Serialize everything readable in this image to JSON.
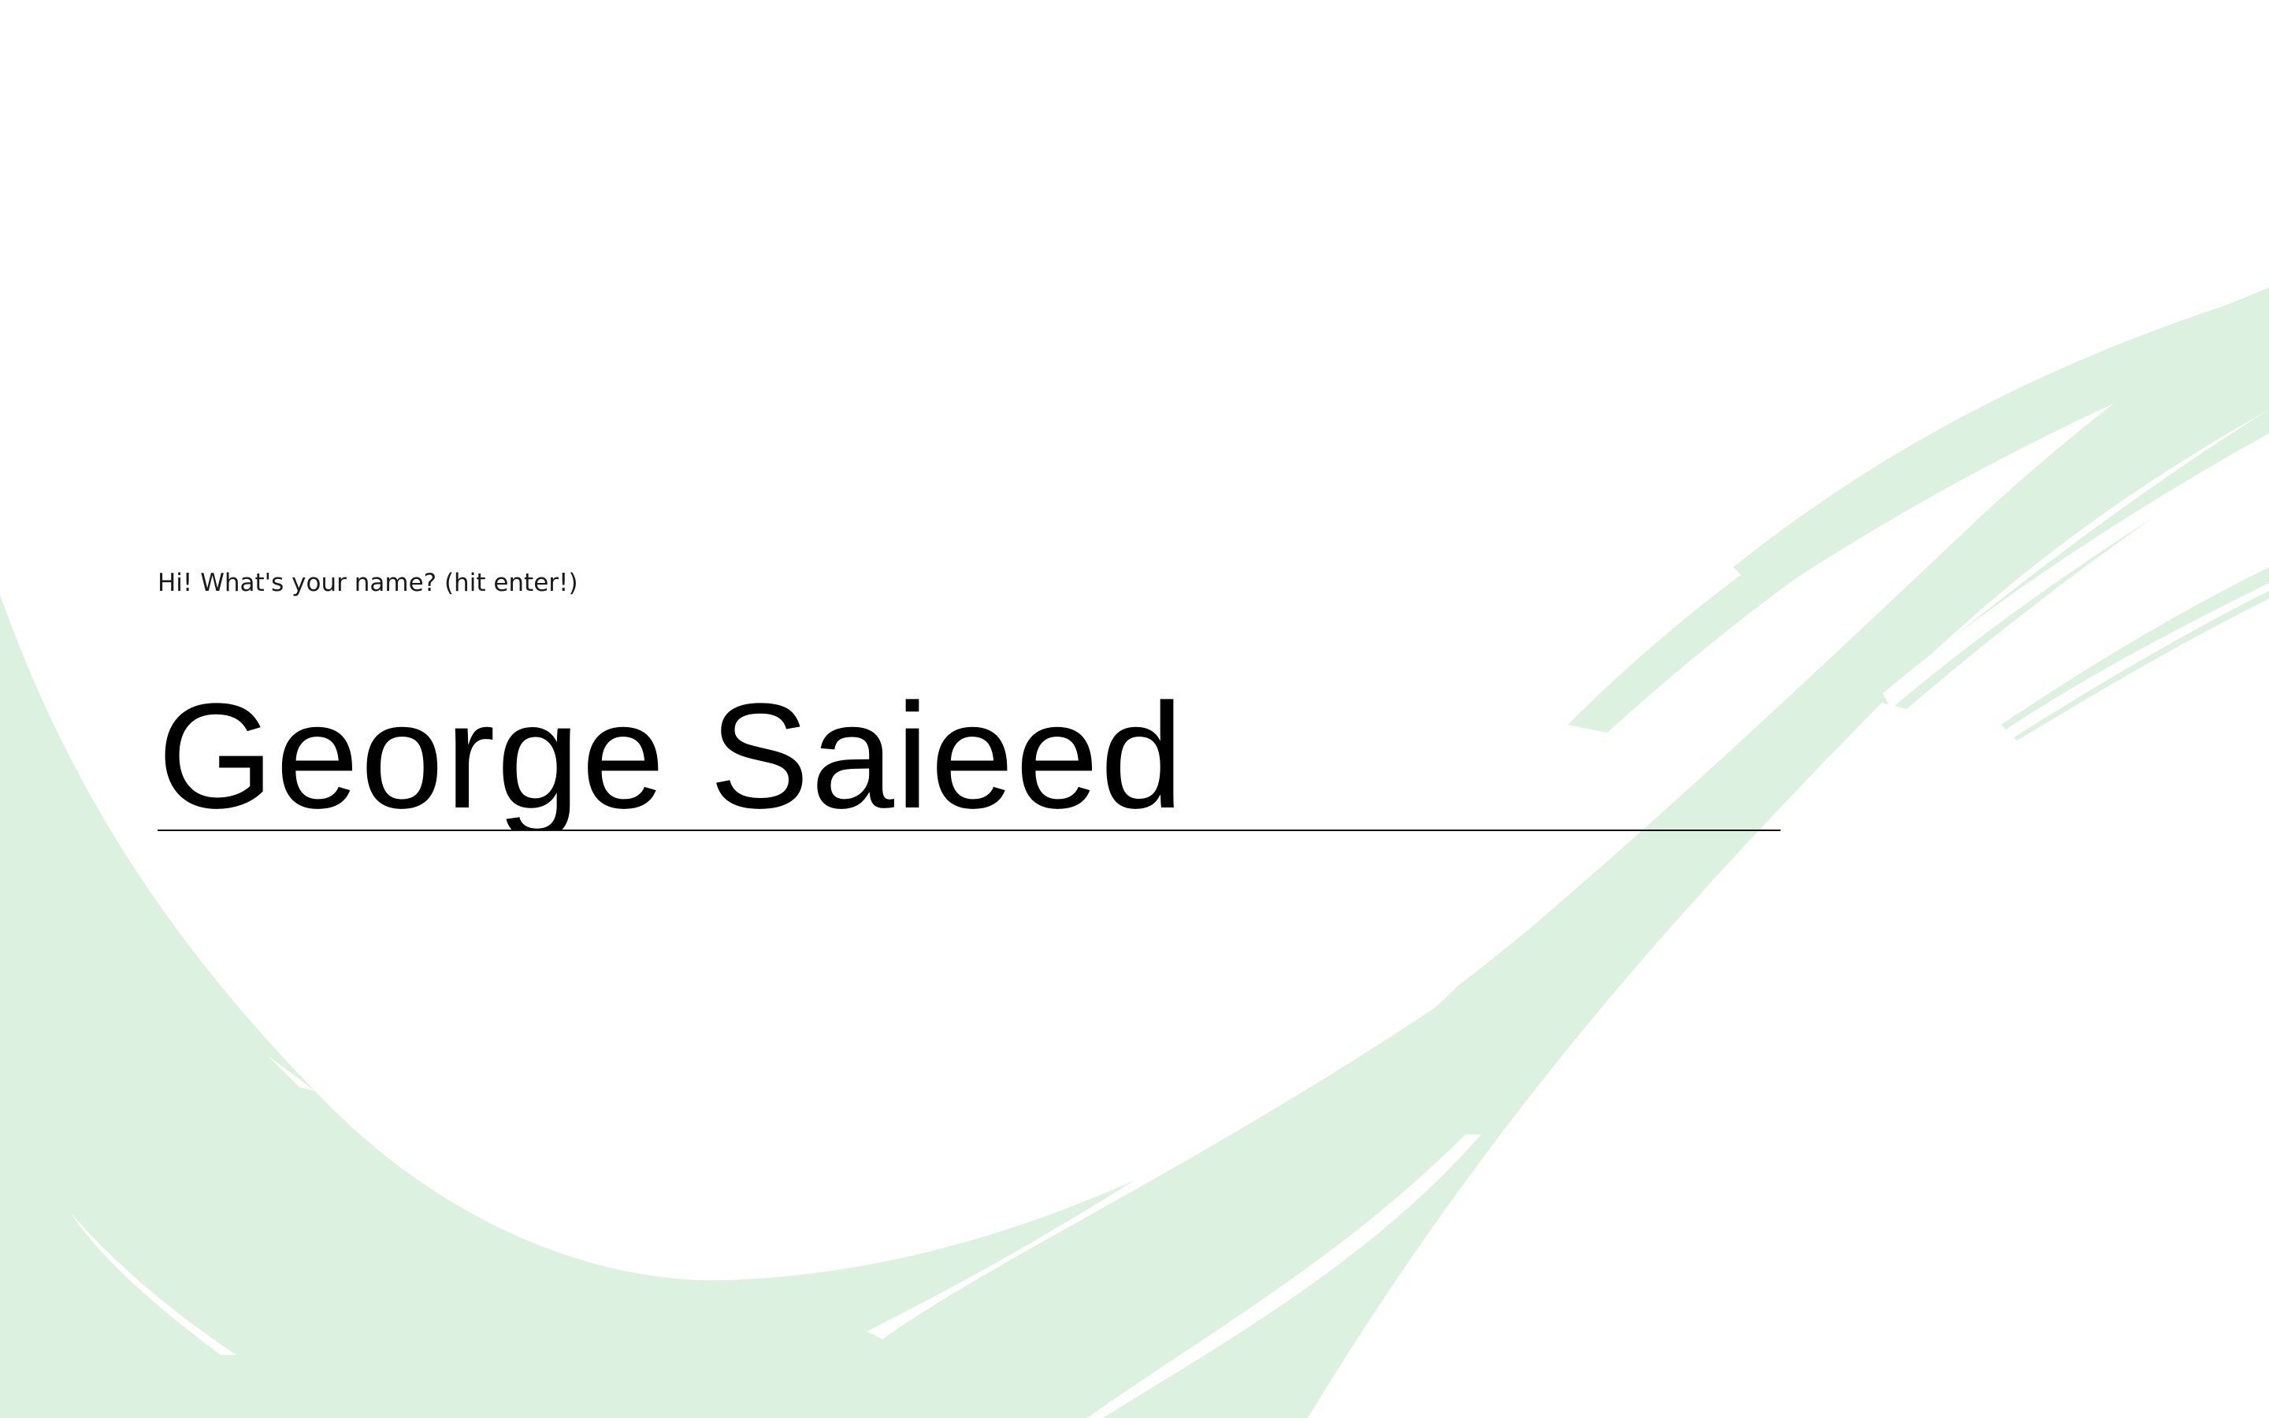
{
  "page": {
    "background_color": "#ffffff",
    "accent_color": "#dcf1e0"
  },
  "prompt": {
    "text": "Hi! What's your name? (hit enter!)"
  },
  "name_input": {
    "value": "George Saieed"
  }
}
